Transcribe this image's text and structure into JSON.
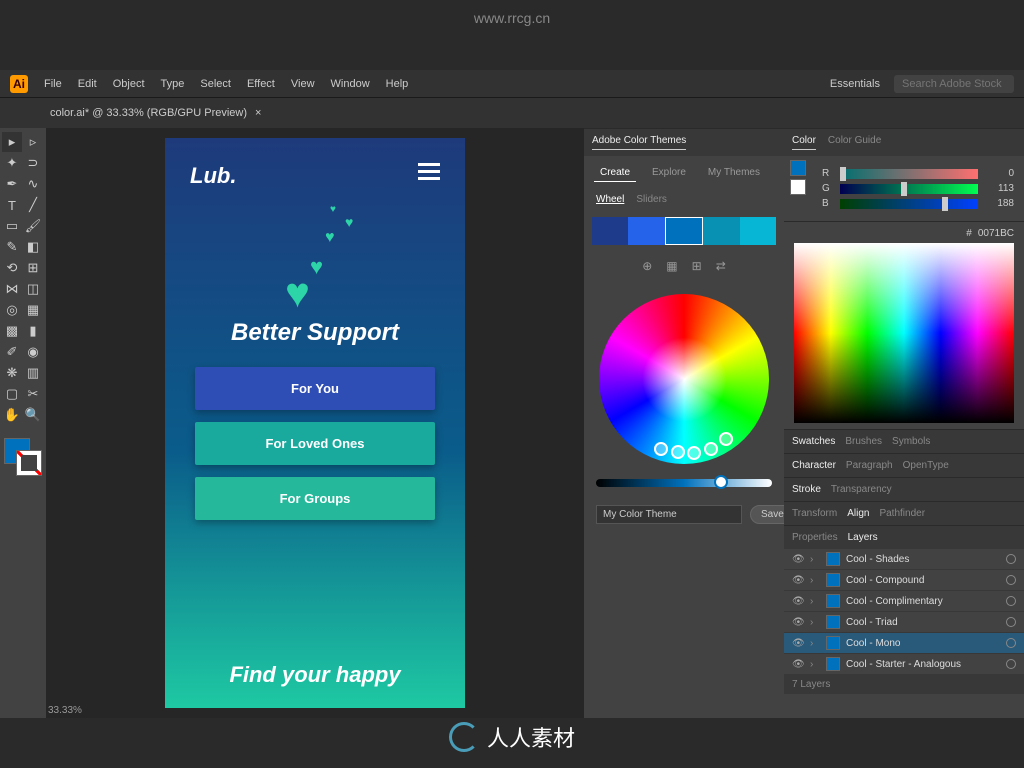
{
  "watermark": {
    "top": "www.rrcg.cn",
    "bottom": "人人素材"
  },
  "menubar": {
    "items": [
      "File",
      "Edit",
      "Object",
      "Type",
      "Select",
      "Effect",
      "View",
      "Window",
      "Help"
    ],
    "workspace": "Essentials",
    "search_placeholder": "Search Adobe Stock"
  },
  "document": {
    "tab_title": "color.ai* @ 33.33% (RGB/GPU Preview)",
    "zoom": "33.33%"
  },
  "artboard": {
    "brand": "Lub.",
    "headline": "Better Support",
    "buttons": [
      "For You",
      "For Loved Ones",
      "For Groups"
    ],
    "footer": "Find your happy"
  },
  "colorThemes": {
    "title": "Adobe Color Themes",
    "tabs": [
      "Create",
      "Explore",
      "My Themes"
    ],
    "modes": [
      "Wheel",
      "Sliders"
    ],
    "theme_name": "My Color Theme",
    "save": "Save"
  },
  "colorPanel": {
    "tabs": [
      "Color",
      "Color Guide"
    ],
    "r": {
      "label": "R",
      "value": "0"
    },
    "g": {
      "label": "G",
      "value": "113"
    },
    "b": {
      "label": "B",
      "value": "188"
    },
    "hex": "0071BC"
  },
  "panelGroups": {
    "a": [
      "Swatches",
      "Brushes",
      "Symbols"
    ],
    "b": [
      "Character",
      "Paragraph",
      "OpenType"
    ],
    "c": [
      "Stroke",
      "Transparency"
    ],
    "d": [
      "Transform",
      "Align",
      "Pathfinder"
    ],
    "e": [
      "Properties",
      "Layers"
    ]
  },
  "layers": {
    "items": [
      {
        "name": "Cool - Shades"
      },
      {
        "name": "Cool - Compound"
      },
      {
        "name": "Cool - Complimentary"
      },
      {
        "name": "Cool - Triad"
      },
      {
        "name": "Cool - Mono"
      },
      {
        "name": "Cool - Starter - Analogous"
      }
    ],
    "footer": "7 Layers"
  }
}
